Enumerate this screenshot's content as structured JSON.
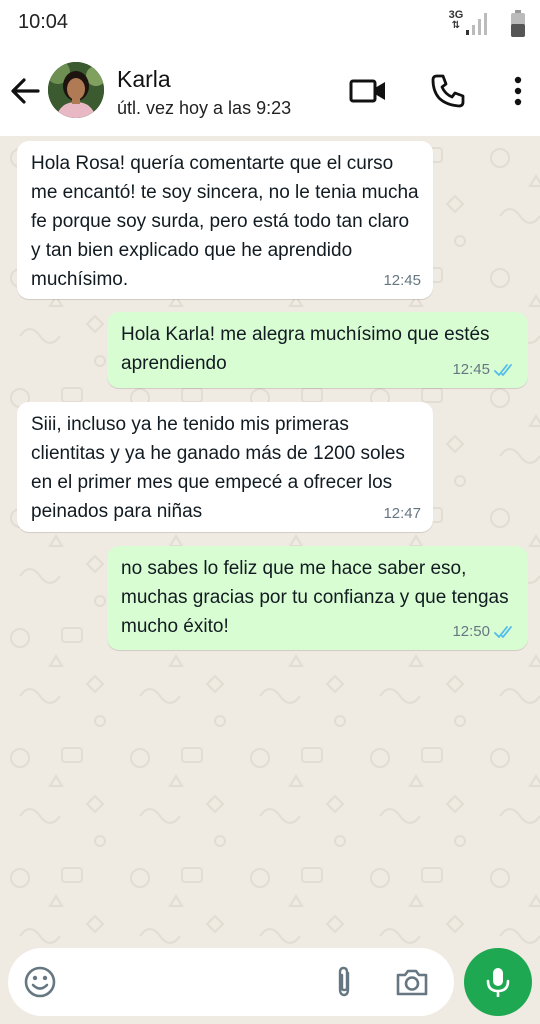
{
  "status_bar": {
    "time": "10:04",
    "network": "3G"
  },
  "header": {
    "contact_name": "Karla",
    "last_seen": "útl. vez hoy a las 9:23",
    "icons": [
      "back-arrow-icon",
      "video-call-icon",
      "phone-icon",
      "more-options-icon"
    ]
  },
  "messages": [
    {
      "direction": "incoming",
      "text": "Hola Rosa! quería comentarte que el curso me encantó! te soy sincera, no le tenia mucha fe porque soy surda, pero está todo tan claro y tan bien explicado que he aprendido muchísimo.",
      "time": "12:45"
    },
    {
      "direction": "outgoing",
      "text": "Hola Karla! me alegra muchísimo que estés aprendiendo",
      "time": "12:45",
      "status": "read"
    },
    {
      "direction": "incoming",
      "text": "Siii, incluso ya he tenido mis primeras clientitas y ya he ganado más de 1200 soles en el primer mes que empecé a ofrecer los peinados para niñas",
      "time": "12:47"
    },
    {
      "direction": "outgoing",
      "text": "no sabes lo feliz que me hace saber eso, muchas gracias por tu confianza y que tengas mucho éxito!",
      "time": "12:50",
      "status": "read"
    }
  ],
  "input": {
    "placeholder": "",
    "value": "",
    "icons": [
      "emoji-icon",
      "attach-icon",
      "camera-icon",
      "mic-icon"
    ]
  },
  "colors": {
    "outgoing_bubble": "#d9fdd3",
    "incoming_bubble": "#ffffff",
    "chat_background": "#efeae2",
    "read_ticks": "#53bdeb",
    "mic_button": "#1da851"
  }
}
